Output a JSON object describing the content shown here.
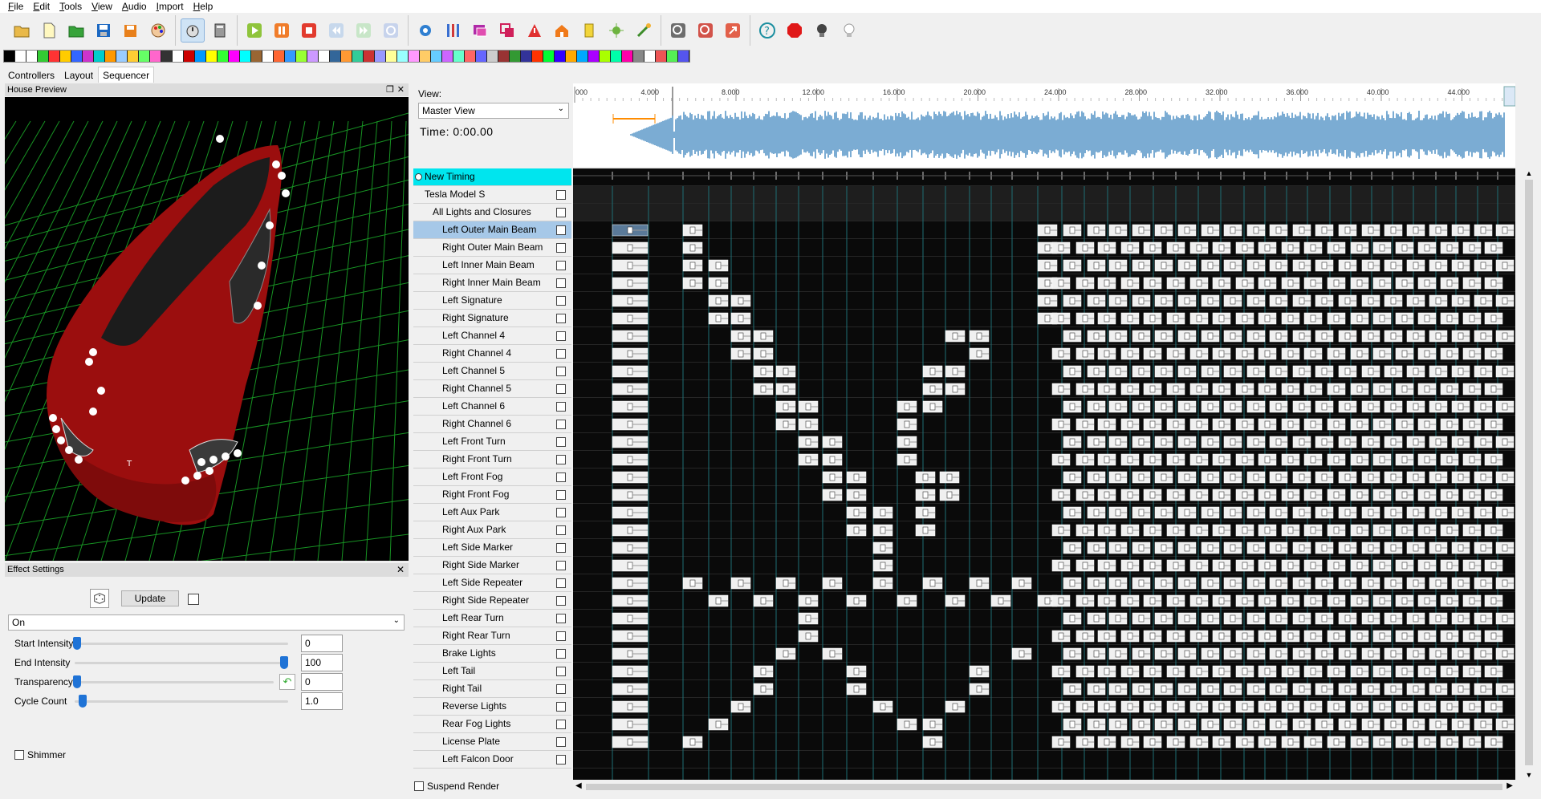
{
  "menu": [
    "File",
    "Edit",
    "Tools",
    "View",
    "Audio",
    "Import",
    "Help"
  ],
  "tabs": [
    "Controllers",
    "Layout",
    "Sequencer"
  ],
  "house_preview": {
    "title": "House Preview"
  },
  "effect_settings": {
    "title": "Effect Settings",
    "update_label": "Update",
    "effect_select": "On",
    "sliders": [
      {
        "label": "Start Intensity",
        "value": "0",
        "level": 0.0
      },
      {
        "label": "End Intensity",
        "value": "100",
        "level": 1.0
      },
      {
        "label": "Transparency",
        "value": "0",
        "level": 0.0
      },
      {
        "label": "Cycle Count",
        "value": "1.0",
        "level": 0.02
      }
    ],
    "shimmer_label": "Shimmer"
  },
  "sequencer": {
    "view_label": "View:",
    "view_value": "Master View",
    "time_label": "Time: 0:00.00",
    "timing_track": "New Timing",
    "model": "Tesla Model S",
    "group": "All Lights and Closures",
    "rows": [
      "Left Outer Main Beam",
      "Right Outer Main Beam",
      "Left Inner Main Beam",
      "Right Inner Main Beam",
      "Left Signature",
      "Right Signature",
      "Left Channel 4",
      "Right Channel 4",
      "Left Channel 5",
      "Right Channel 5",
      "Left Channel 6",
      "Right Channel 6",
      "Left Front Turn",
      "Right Front Turn",
      "Left Front Fog",
      "Right Front Fog",
      "Left Aux Park",
      "Right Aux Park",
      "Left Side Marker",
      "Right Side Marker",
      "Left Side Repeater",
      "Right Side Repeater",
      "Left Rear Turn",
      "Right Rear Turn",
      "Brake Lights",
      "Left Tail",
      "Right Tail",
      "Reverse Lights",
      "Rear Fog Lights",
      "License Plate",
      "Left Falcon Door"
    ],
    "ruler_ticks": [
      "000",
      "4.000",
      "8.000",
      "12.000",
      "16.000",
      "20.000",
      "24.000",
      "28.000",
      "32.000",
      "36.000",
      "40.000",
      "44.000"
    ],
    "suspend_render_label": "Suspend Render",
    "colors": {
      "timing": "#00e5ee",
      "waveform": "#7bacd3",
      "grid_line": "#1d6e74",
      "selected": "#a6c8e8"
    }
  }
}
